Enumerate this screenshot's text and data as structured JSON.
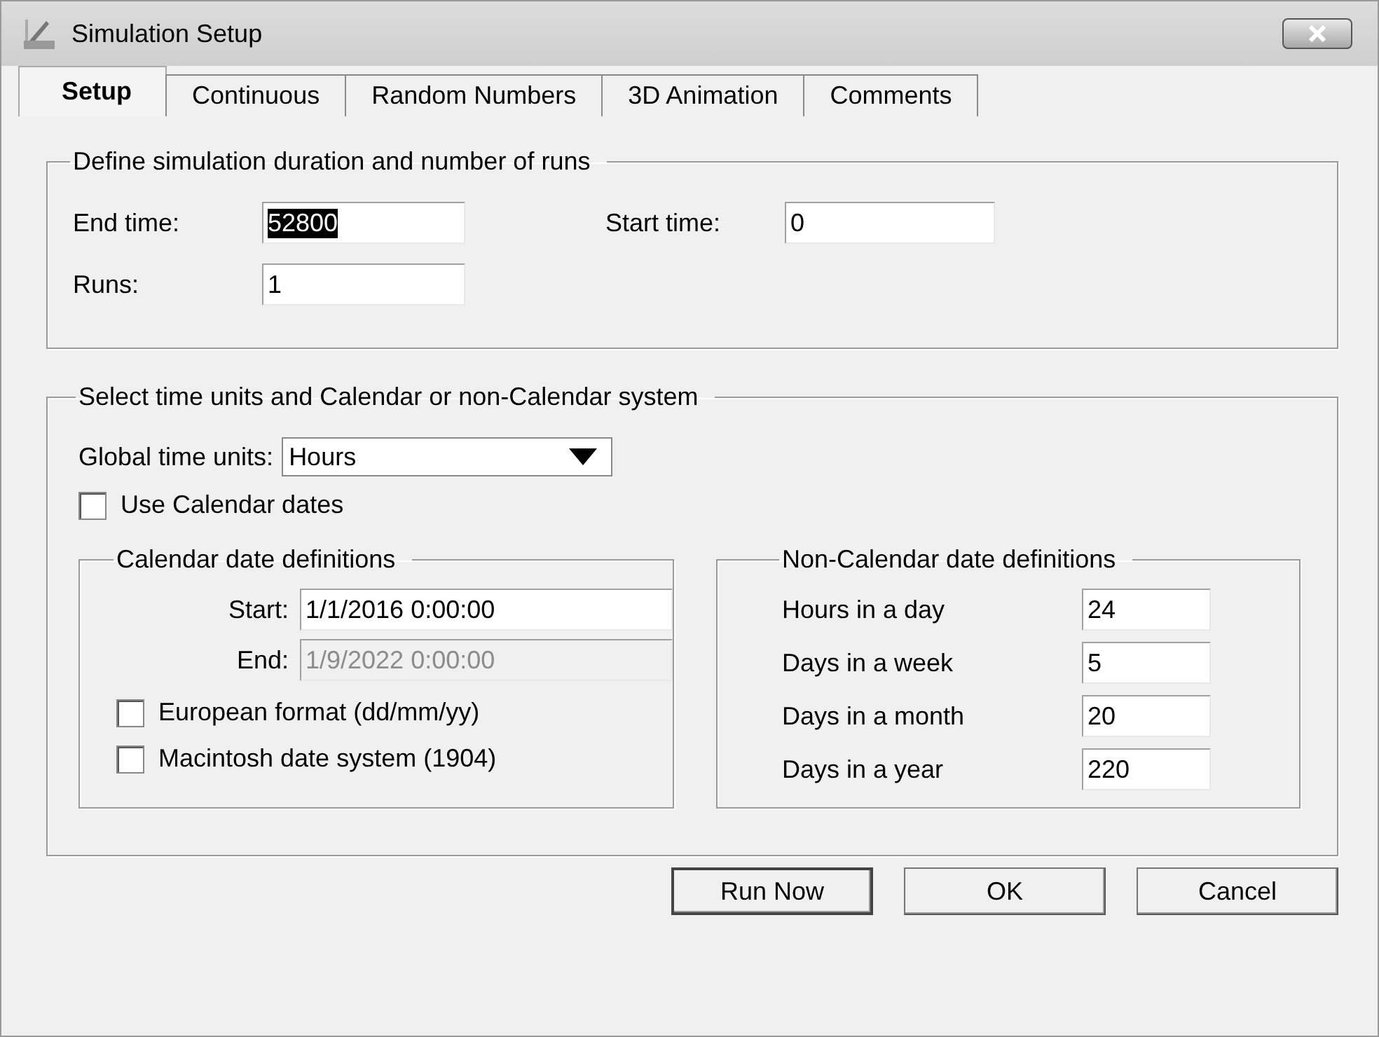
{
  "window": {
    "title": "Simulation Setup"
  },
  "tabs": [
    {
      "label": "Setup",
      "selected": true
    },
    {
      "label": "Continuous",
      "selected": false
    },
    {
      "label": "Random Numbers",
      "selected": false
    },
    {
      "label": "3D Animation",
      "selected": false
    },
    {
      "label": "Comments",
      "selected": false
    }
  ],
  "duration": {
    "legend": "Define simulation duration and number of runs",
    "end_time": {
      "label": "End time:",
      "value": "52800",
      "text_selected": true
    },
    "start_time": {
      "label": "Start time:",
      "value": "0",
      "text_selected": false
    },
    "runs": {
      "label": "Runs:",
      "value": "1",
      "text_selected": false
    }
  },
  "units": {
    "legend": "Select time units and Calendar or non-Calendar system",
    "global_time_units": {
      "label": "Global time units:",
      "value": "Hours"
    },
    "use_calendar": {
      "label": "Use Calendar dates",
      "checked": false
    },
    "calendar": {
      "legend": "Calendar date definitions",
      "fields": [
        {
          "label": "Start:",
          "value": "1/1/2016 0:00:00",
          "disabled": false
        },
        {
          "label": "End:",
          "value": "1/9/2022 0:00:00",
          "disabled": true
        }
      ],
      "options": [
        {
          "label": "European format (dd/mm/yy)",
          "checked": false
        },
        {
          "label": "Macintosh date system (1904)",
          "checked": false
        }
      ]
    },
    "non_calendar": {
      "legend": "Non-Calendar date definitions",
      "fields": [
        {
          "label": "Hours in a day",
          "value": "24"
        },
        {
          "label": "Days in a week",
          "value": "5"
        },
        {
          "label": "Days in a month",
          "value": "20"
        },
        {
          "label": "Days in a year",
          "value": "220"
        }
      ]
    }
  },
  "buttons": [
    {
      "label": "Run Now",
      "default": true
    },
    {
      "label": "OK",
      "default": false
    },
    {
      "label": "Cancel",
      "default": false
    }
  ]
}
